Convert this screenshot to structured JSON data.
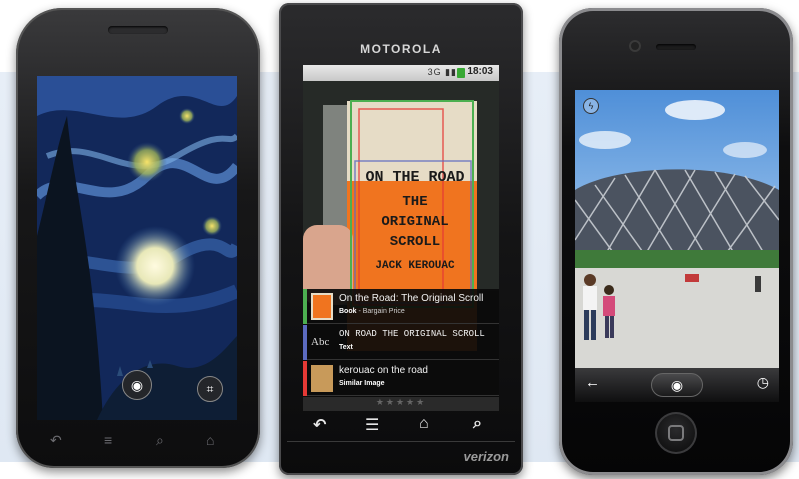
{
  "phone_left": {
    "nav_keys": [
      "back-icon",
      "menu-icon",
      "search-icon",
      "home-icon"
    ],
    "camera_button": "camera-icon",
    "crop_button": "crop-icon"
  },
  "phone_middle": {
    "brand": "MOTOROLA",
    "status": {
      "clock": "18:03",
      "icons": "3G ▮▮"
    },
    "book_cover": {
      "line1": "ON THE ROAD",
      "line2": "THE",
      "line3": "ORIGINAL",
      "line4": "SCROLL",
      "line5": "JACK KEROUAC"
    },
    "results": [
      {
        "title": "On the Road: The Original Scroll",
        "type": "Book",
        "detail": " - Bargain Price",
        "color": "#4caf50"
      },
      {
        "title": "ON ROAD THE ORIGINAL SCROLL",
        "type": "Text",
        "detail": "",
        "color": "#5c6bc0"
      },
      {
        "title": "kerouac on the road",
        "type": "Similar Image",
        "detail": "",
        "color": "#e53935"
      }
    ],
    "rating": "★★★★★",
    "thumb_text_label": "Abc",
    "nav_keys": [
      "back-icon",
      "menu-icon",
      "home-icon",
      "search-icon"
    ],
    "carrier": "verizon"
  },
  "phone_right": {
    "toolbar": {
      "left": "back-arrow-icon",
      "center": "camera-icon",
      "right": "history-icon"
    },
    "flash": "flash-toggle-icon"
  }
}
